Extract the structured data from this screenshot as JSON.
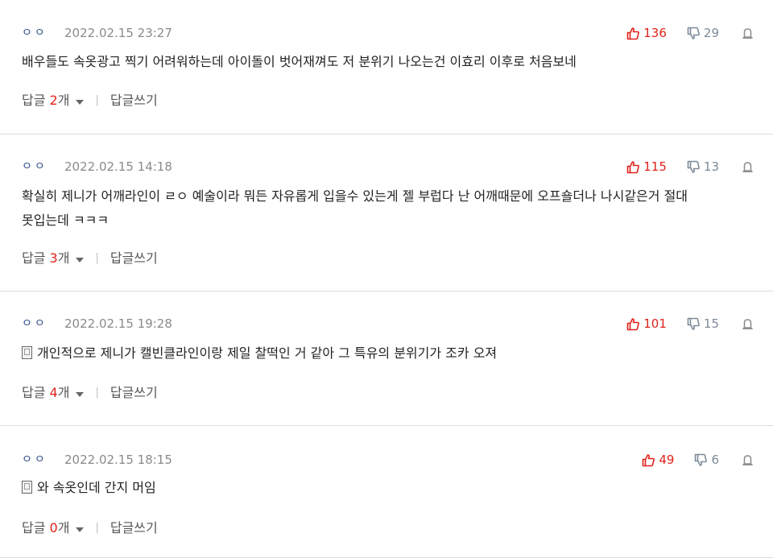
{
  "comments": [
    {
      "author": "ㅇㅇ",
      "date": "2022.02.15 23:27",
      "likes": "136",
      "dislikes": "29",
      "mobile": false,
      "text": [
        "배우들도 속옷광고 찍기 어려워하는데 아이돌이 벗어재껴도 저 분위기 나오는건 이효리 이후로 처음보네"
      ],
      "reply_label": "답글",
      "reply_count": "2",
      "reply_unit": "개",
      "write_reply": "답글쓰기"
    },
    {
      "author": "ㅇㅇ",
      "date": "2022.02.15 14:18",
      "likes": "115",
      "dislikes": "13",
      "mobile": false,
      "text": [
        "확실히 제니가 어깨라인이 ㄹㅇ 예술이라 뭐든 자유롭게 입을수 있는게 젤 부럽다 난 어깨때문에 오프숄더나 나시같은거 절대",
        "못입는데 ㅋㅋㅋ"
      ],
      "reply_label": "답글",
      "reply_count": "3",
      "reply_unit": "개",
      "write_reply": "답글쓰기"
    },
    {
      "author": "ㅇㅇ",
      "date": "2022.02.15 19:28",
      "likes": "101",
      "dislikes": "15",
      "mobile": true,
      "text": [
        "개인적으로 제니가 캘빈클라인이랑 제일 찰떡인 거 같아 그 특유의 분위기가 조카 오져"
      ],
      "reply_label": "답글",
      "reply_count": "4",
      "reply_unit": "개",
      "write_reply": "답글쓰기"
    },
    {
      "author": "ㅇㅇ",
      "date": "2022.02.15 18:15",
      "likes": "49",
      "dislikes": "6",
      "mobile": true,
      "text": [
        "와 속옷인데 간지 머임"
      ],
      "reply_label": "답글",
      "reply_count": "0",
      "reply_unit": "개",
      "write_reply": "답글쓰기"
    }
  ]
}
